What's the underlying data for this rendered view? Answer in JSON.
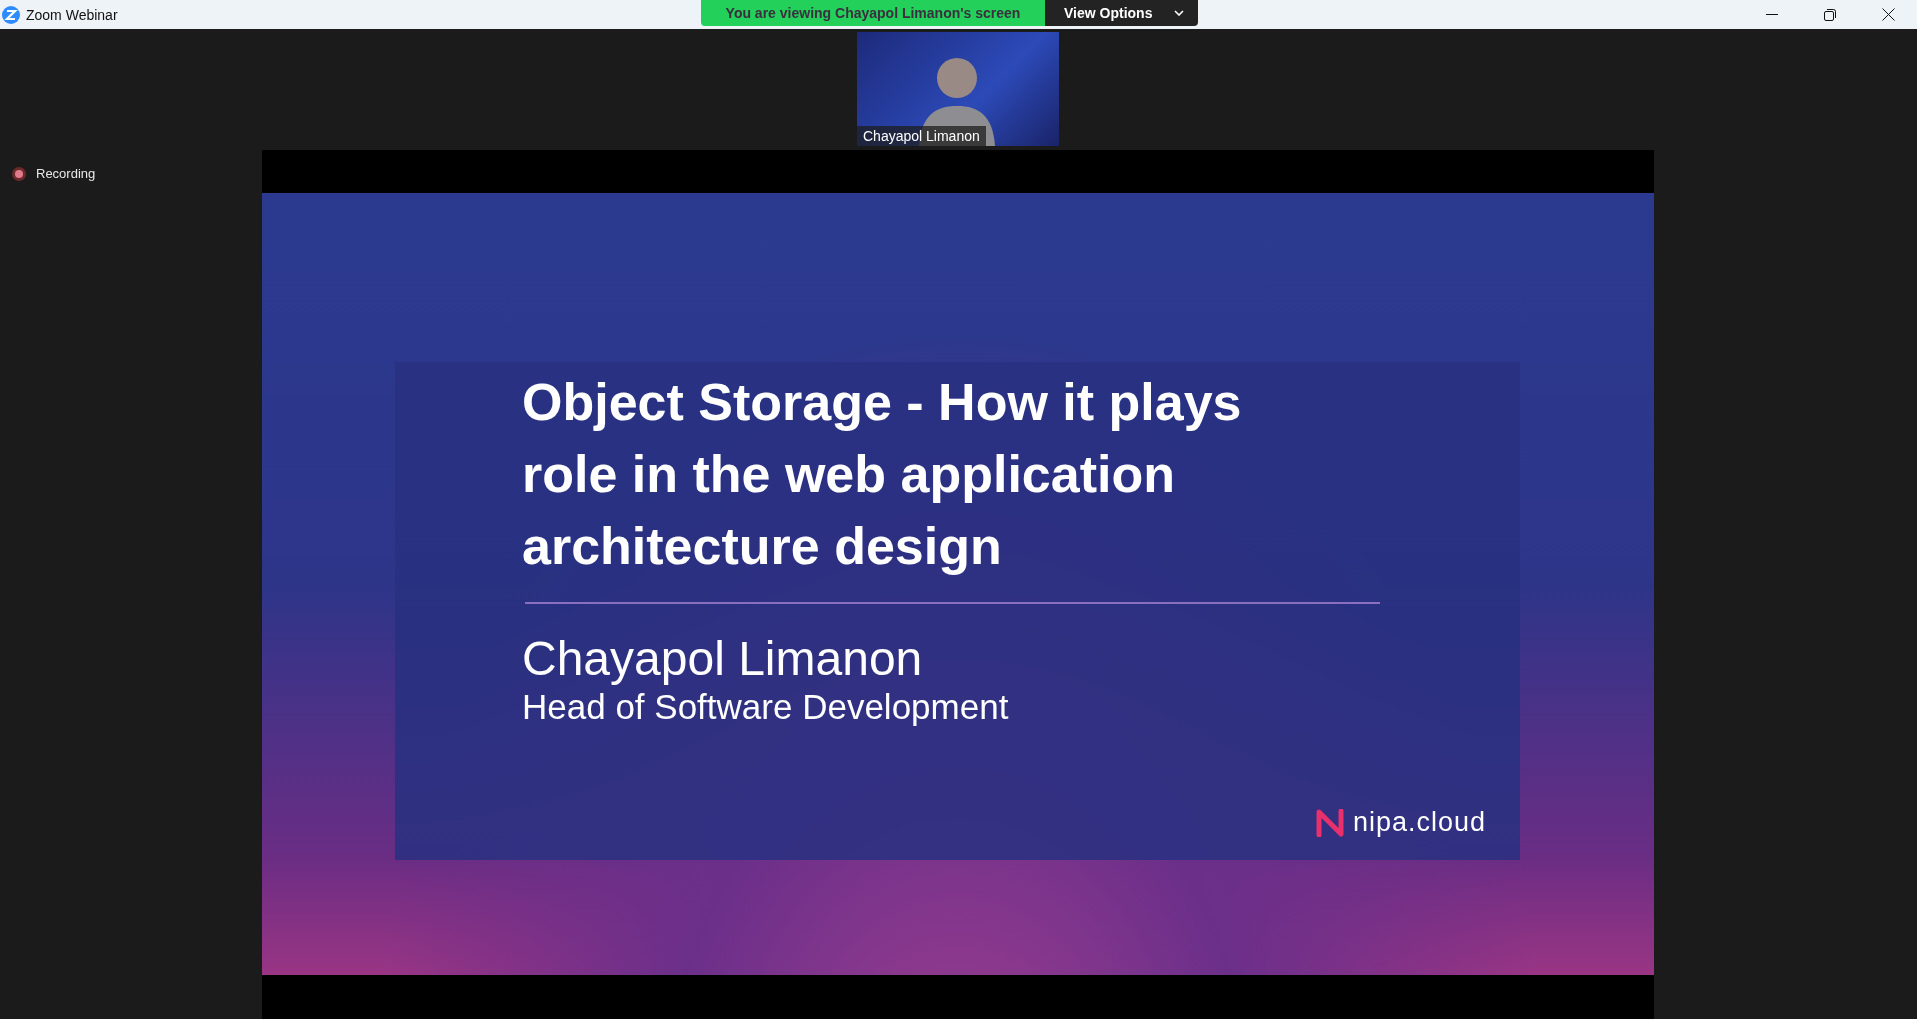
{
  "window": {
    "title": "Zoom Webinar"
  },
  "share_banner": {
    "message": "You are viewing Chayapol Limanon's screen",
    "view_options": "View Options"
  },
  "video_tile": {
    "name": "Chayapol Limanon"
  },
  "recording": {
    "label": "Recording"
  },
  "slide": {
    "title_lines": [
      "Object Storage - How it plays",
      "role in the web application",
      "architecture design"
    ],
    "presenter": "Chayapol Limanon",
    "role": "Head of Software Development",
    "brand": "nipa.cloud"
  }
}
